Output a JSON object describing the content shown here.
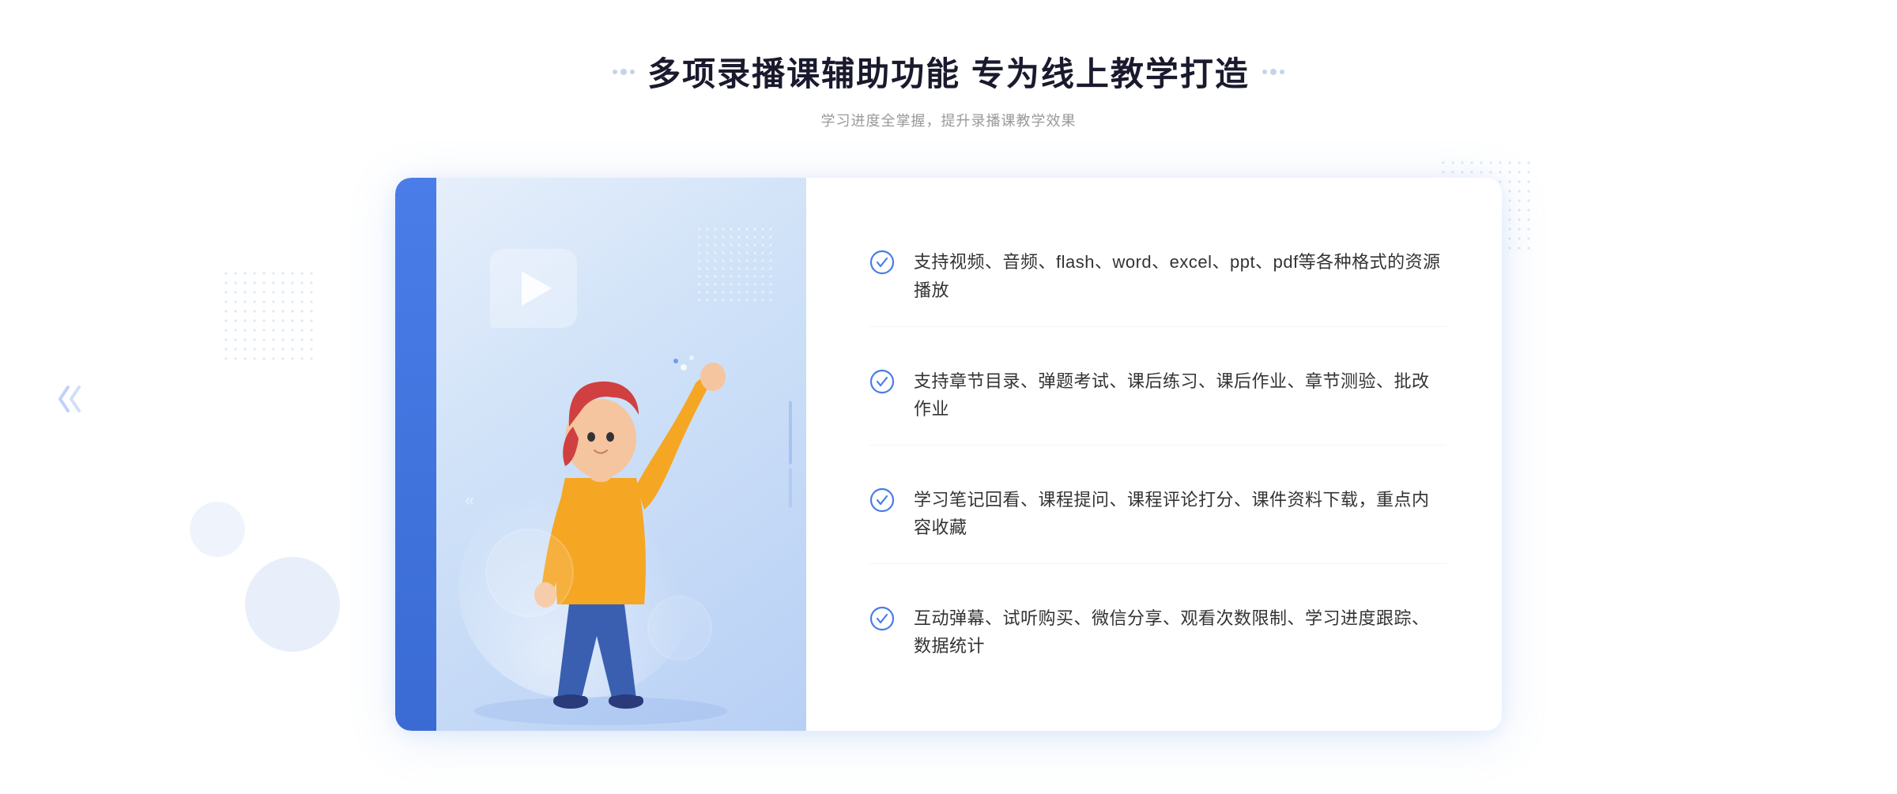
{
  "header": {
    "title": "多项录播课辅助功能 专为线上教学打造",
    "subtitle": "学习进度全掌握，提升录播课教学效果",
    "decorator_left": ":::",
    "decorator_right": ":::"
  },
  "features": [
    {
      "id": "feature-1",
      "text": "支持视频、音频、flash、word、excel、ppt、pdf等各种格式的资源播放"
    },
    {
      "id": "feature-2",
      "text": "支持章节目录、弹题考试、课后练习、课后作业、章节测验、批改作业"
    },
    {
      "id": "feature-3",
      "text": "学习笔记回看、课程提问、课程评论打分、课件资料下载，重点内容收藏"
    },
    {
      "id": "feature-4",
      "text": "互动弹幕、试听购买、微信分享、观看次数限制、学习进度跟踪、数据统计"
    }
  ],
  "colors": {
    "accent_blue": "#4a7de8",
    "light_blue": "#e8f0fb",
    "text_dark": "#1a1a2e",
    "text_gray": "#999999",
    "check_blue": "#4a7de8"
  },
  "icons": {
    "check": "check-circle-icon",
    "play": "play-icon",
    "chevron": "chevron-icon"
  }
}
